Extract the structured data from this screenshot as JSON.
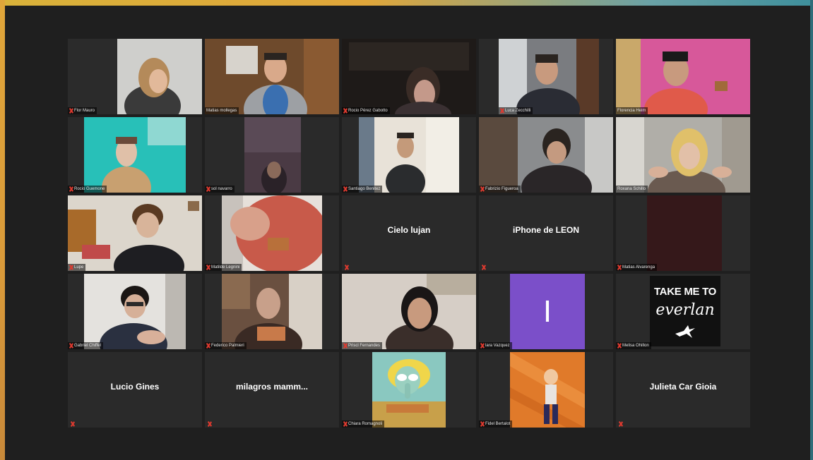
{
  "gallery": {
    "participants": [
      {
        "name": "Flor Mauro"
      },
      {
        "name": "Matias mollegas"
      },
      {
        "name": "Rocio Pérez Gabotto"
      },
      {
        "name": "Luca Zecchilli"
      },
      {
        "name": "Florencia Heim"
      },
      {
        "name": "Rocio Guemone"
      },
      {
        "name": "sol navarro"
      },
      {
        "name": "Santiago Benitez"
      },
      {
        "name": "Fabrizio Figueroa"
      },
      {
        "name": "Roxana Schillo"
      },
      {
        "name": "Lupe"
      },
      {
        "name": "Matilde Legnini"
      },
      {
        "name": "Cielo lujan"
      },
      {
        "name": "iPhone de LEON"
      },
      {
        "name": "Matias Alvarenga"
      },
      {
        "name": "Gabriel Chiffel"
      },
      {
        "name": "Federico Palmieri"
      },
      {
        "name": "Priscl Fernandes"
      },
      {
        "name": "lara Vazquez"
      },
      {
        "name": "Melisa Ohillon"
      },
      {
        "name": "Lucio Gines"
      },
      {
        "name": "milagros  mamm..."
      },
      {
        "name": "Chiara Romagnoli"
      },
      {
        "name": "Fidel Bertalot"
      },
      {
        "name": "Julieta Car Gioia"
      }
    ],
    "avatar_letter": "I",
    "poster_text": {
      "line1": "TAKE ME TO",
      "line2": "everlan"
    },
    "active_speaker_color": "#c8d84a",
    "muted_icon": "mic-muted-icon"
  }
}
